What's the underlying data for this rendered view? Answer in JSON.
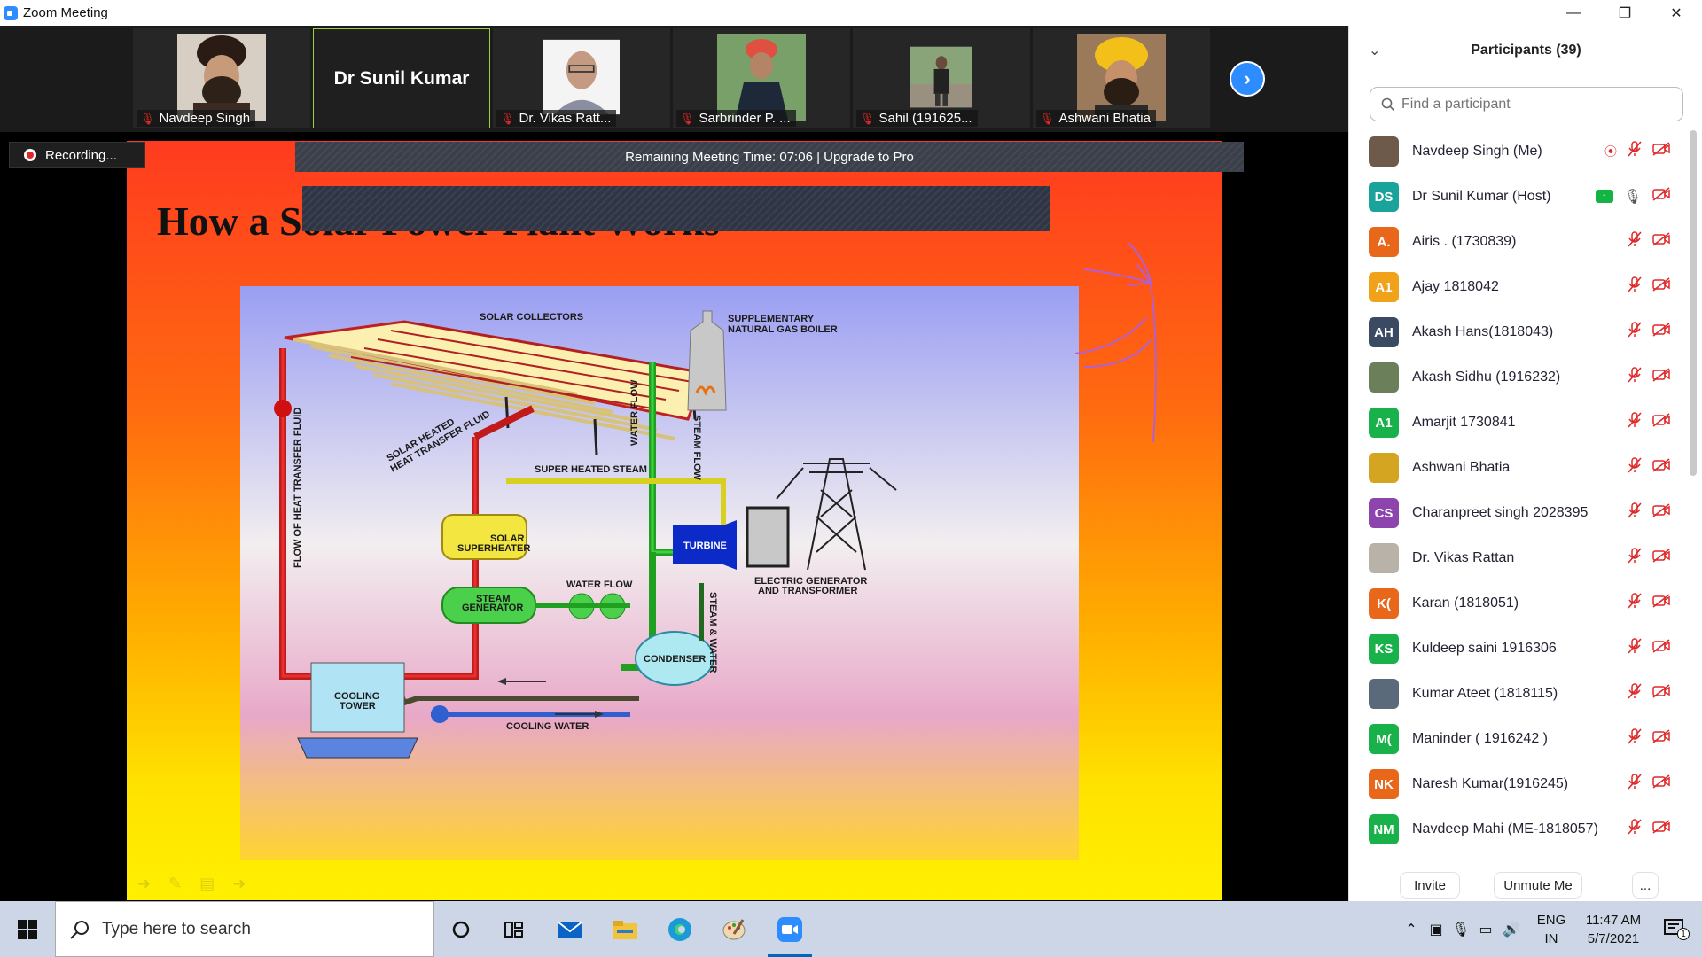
{
  "window": {
    "title": "Zoom Meeting",
    "min": "—",
    "restore": "❐",
    "close": "✕"
  },
  "gallery": {
    "tiles": [
      {
        "name": "Navdeep Singh"
      },
      {
        "name": "Dr Sunil Kumar"
      },
      {
        "name": "Dr. Vikas Ratt..."
      },
      {
        "name": "Sarbrinder P. ..."
      },
      {
        "name": "Sahil (191625..."
      },
      {
        "name": "Ashwani Bhatia"
      }
    ],
    "next_icon": "chevron-right-icon"
  },
  "recording": {
    "label": "Recording..."
  },
  "time_banner": "Remaining Meeting Time: 07:06 | Upgrade to Pro",
  "slide": {
    "title": "How a Solar Power Plant Works",
    "labels": {
      "solar_collectors": "SOLAR COLLECTORS",
      "supplementary": "SUPPLEMENTARY",
      "natural_gas_boiler": "NATURAL GAS BOILER",
      "water_flow_vertical": "WATER FLOW",
      "steam_flow": "STEAM FLOW",
      "solar_heated_1": "SOLAR HEATED",
      "solar_heated_2": "HEAT TRANSFER FLUID",
      "flow_of_heat": "FLOW OF HEAT TRANSFER FLUID",
      "super_heated_steam": "SUPER HEATED STEAM",
      "solar_superheater_1": "SOLAR",
      "solar_superheater_2": "SUPERHEATER",
      "turbine": "TURBINE",
      "electric_gen_1": "ELECTRIC GENERATOR",
      "electric_gen_2": "AND TRANSFORMER",
      "water_flow": "WATER FLOW",
      "steam_generator_1": "STEAM",
      "steam_generator_2": "GENERATOR",
      "steam_water": "STEAM & WATER",
      "condenser": "CONDENSER",
      "cooling_tower_1": "COOLING",
      "cooling_tower_2": "TOWER",
      "cooling_water": "COOLING WATER"
    }
  },
  "panel": {
    "title": "Participants (39)",
    "search_placeholder": "Find a participant",
    "participants": [
      {
        "name": "Navdeep Singh (Me)",
        "initials": "",
        "color": "#6d5a4a",
        "photo": true
      },
      {
        "name": "Dr Sunil Kumar (Host)",
        "initials": "DS",
        "color": "#1aa39a",
        "photo": false
      },
      {
        "name": "Airis . (1730839)",
        "initials": "A.",
        "color": "#e8671b",
        "photo": false
      },
      {
        "name": "Ajay 1818042",
        "initials": "A1",
        "color": "#f0a31a",
        "photo": false
      },
      {
        "name": "Akash Hans(1818043)",
        "initials": "AH",
        "color": "#3b4a63",
        "photo": false
      },
      {
        "name": "Akash Sidhu (1916232)",
        "initials": "",
        "color": "#6a7f5a",
        "photo": true
      },
      {
        "name": "Amarjit 1730841",
        "initials": "A1",
        "color": "#19b14a",
        "photo": false
      },
      {
        "name": "Ashwani Bhatia",
        "initials": "",
        "color": "#d4a520",
        "photo": true
      },
      {
        "name": "Charanpreet singh 2028395",
        "initials": "CS",
        "color": "#8e44ad",
        "photo": false
      },
      {
        "name": "Dr. Vikas Rattan",
        "initials": "",
        "color": "#b9b2a8",
        "photo": true
      },
      {
        "name": "Karan (1818051)",
        "initials": "K(",
        "color": "#e8671b",
        "photo": false
      },
      {
        "name": "Kuldeep saini 1916306",
        "initials": "KS",
        "color": "#19b14a",
        "photo": false
      },
      {
        "name": "Kumar Ateet (1818115)",
        "initials": "",
        "color": "#5a6a7a",
        "photo": true
      },
      {
        "name": "Maninder ( 1916242 )",
        "initials": "M(",
        "color": "#19b14a",
        "photo": false
      },
      {
        "name": "Naresh Kumar(1916245)",
        "initials": "NK",
        "color": "#e8671b",
        "photo": false
      },
      {
        "name": "Navdeep Mahi (ME-1818057)",
        "initials": "NM",
        "color": "#19b14a",
        "photo": false
      }
    ],
    "invite": "Invite",
    "unmute": "Unmute Me",
    "more": "..."
  },
  "taskbar": {
    "search_placeholder": "Type here to search",
    "lang_1": "ENG",
    "lang_2": "IN",
    "time": "11:47 AM",
    "date": "5/7/2021",
    "notification_count": "1"
  }
}
